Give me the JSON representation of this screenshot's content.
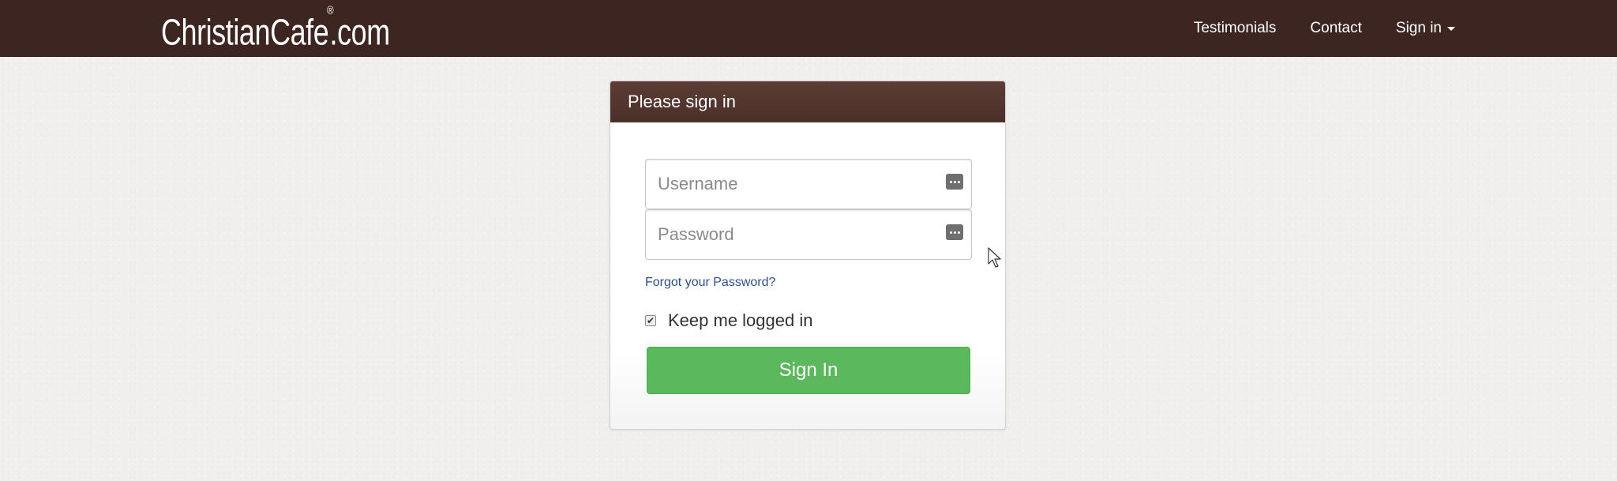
{
  "header": {
    "brand": "ChristianCafe",
    "brand_registered": "®",
    "brand_suffix": ".com",
    "nav": [
      {
        "label": "Testimonials"
      },
      {
        "label": "Contact"
      },
      {
        "label": "Sign in"
      }
    ]
  },
  "login": {
    "heading": "Please sign in",
    "username_placeholder": "Username",
    "password_placeholder": "Password",
    "forgot_label": "Forgot your Password?",
    "remember_label": "Keep me logged in",
    "remember_checked": true,
    "submit_label": "Sign In"
  },
  "colors": {
    "navbar": "#3d2622",
    "panel_heading": "#4e322c",
    "primary_button": "#5cb85c",
    "link": "#2b4f8f",
    "background": "#f0efed"
  },
  "icons": {
    "password_manager": "password-manager-icon",
    "dropdown": "caret-down-icon",
    "checkmark": "checkmark-icon",
    "cursor": "mouse-pointer-icon"
  }
}
